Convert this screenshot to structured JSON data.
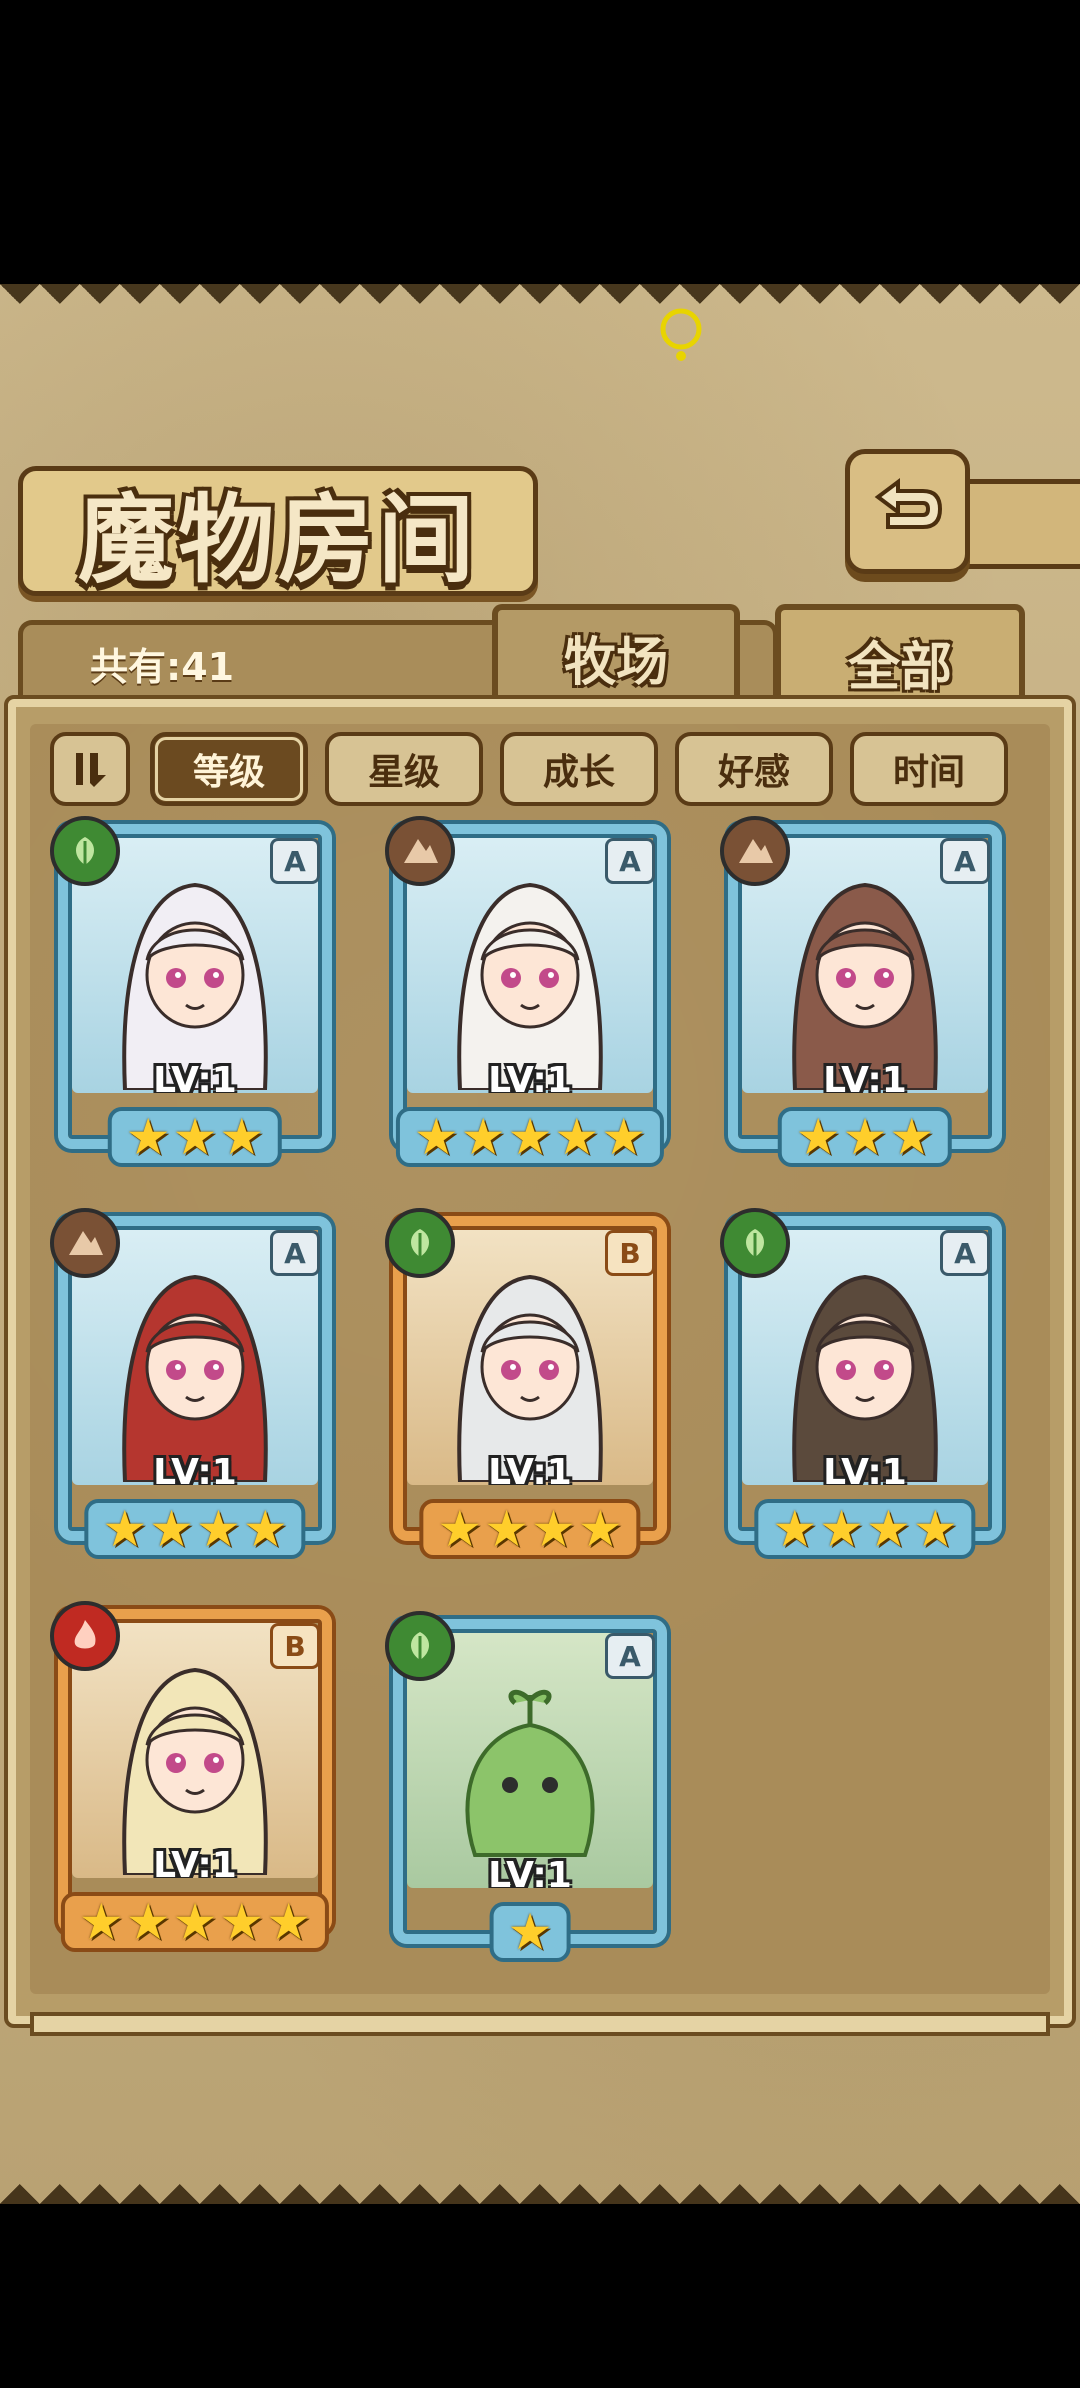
{
  "title": "魔物房间",
  "count_label": "共有:41",
  "tabs": {
    "farm": "牧场",
    "all": "全部"
  },
  "sort": {
    "level": "等级",
    "star": "星级",
    "growth": "成长",
    "affinity": "好感",
    "time": "时间"
  },
  "cards": [
    {
      "element": "leaf",
      "rank": "A",
      "level": "LV:1",
      "stars": 3,
      "frame": "blue"
    },
    {
      "element": "earth",
      "rank": "A",
      "level": "LV:1",
      "stars": 5,
      "frame": "blue"
    },
    {
      "element": "earth",
      "rank": "A",
      "level": "LV:1",
      "stars": 3,
      "frame": "blue"
    },
    {
      "element": "earth",
      "rank": "A",
      "level": "LV:1",
      "stars": 4,
      "frame": "blue"
    },
    {
      "element": "leaf",
      "rank": "B",
      "level": "LV:1",
      "stars": 4,
      "frame": "orange"
    },
    {
      "element": "leaf",
      "rank": "A",
      "level": "LV:1",
      "stars": 4,
      "frame": "blue"
    },
    {
      "element": "fire",
      "rank": "B",
      "level": "LV:1",
      "stars": 5,
      "frame": "orange"
    },
    {
      "element": "leaf",
      "rank": "A",
      "level": "LV:1",
      "stars": 1,
      "frame": "blue"
    }
  ],
  "colors": {
    "frame_blue": "#7fc3dc",
    "frame_orange": "#e9a04c",
    "star": "#ffce2b",
    "parchment": "#c9b487"
  }
}
